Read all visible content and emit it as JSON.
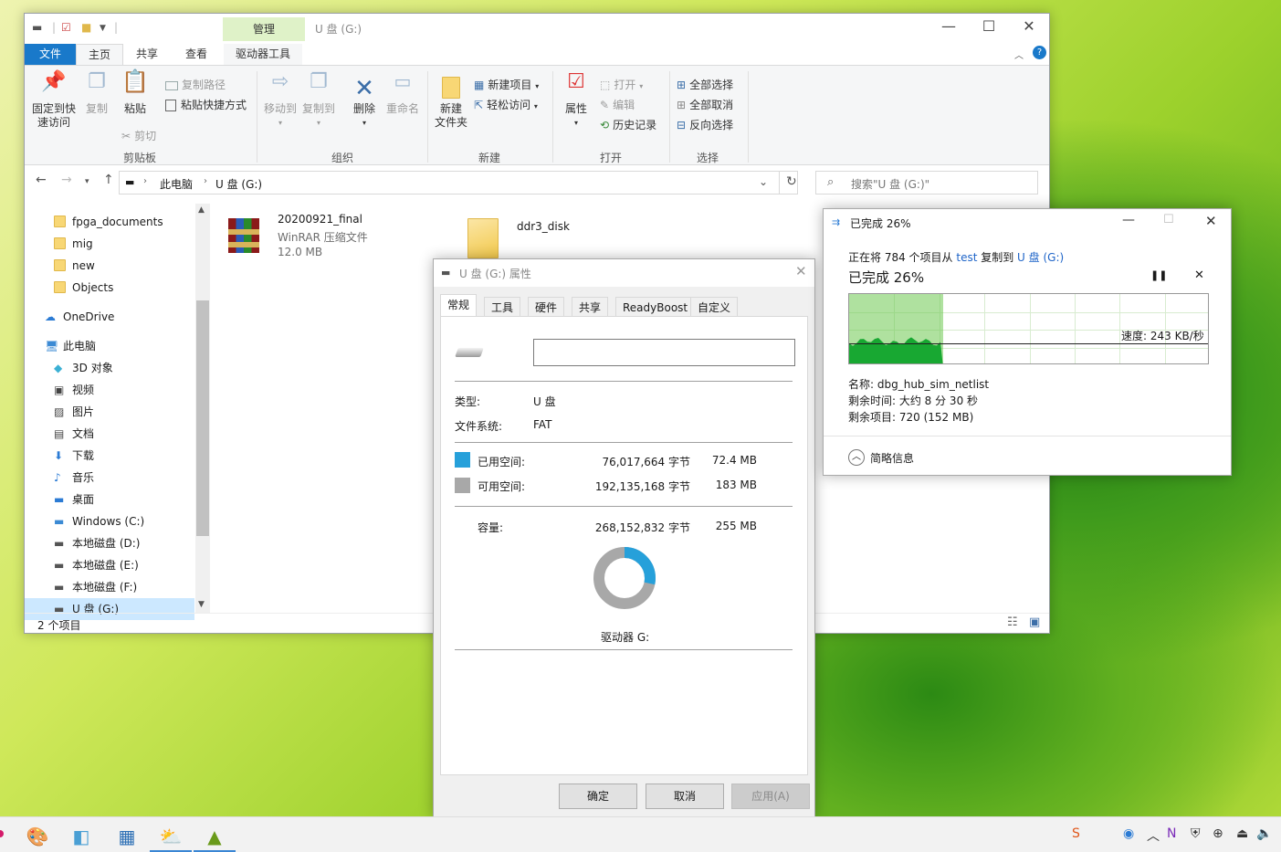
{
  "explorer": {
    "title": "U 盘 (G:)",
    "manage_tab": "管理",
    "tabs": [
      "文件",
      "主页",
      "共享",
      "查看",
      "驱动器工具"
    ],
    "ribbon": {
      "clipboard": {
        "pin": "固定到快\n速访问",
        "copy": "复制",
        "paste": "粘贴",
        "copy_path": "复制路径",
        "paste_shortcut": "粘贴快捷方式",
        "cut": "剪切",
        "group": "剪贴板"
      },
      "organize": {
        "move_to": "移动到",
        "copy_to": "复制到",
        "delete": "删除",
        "rename": "重命名",
        "group": "组织"
      },
      "new": {
        "new_folder": "新建\n文件夹",
        "new_item": "新建项目",
        "easy_access": "轻松访问",
        "group": "新建"
      },
      "open": {
        "properties": "属性",
        "open": "打开",
        "edit": "编辑",
        "history": "历史记录",
        "group": "打开"
      },
      "select": {
        "select_all": "全部选择",
        "select_none": "全部取消",
        "invert": "反向选择",
        "group": "选择"
      }
    },
    "address": {
      "crumbs": [
        "此电脑",
        "U 盘 (G:)"
      ]
    },
    "search_placeholder": "搜索\"U 盘 (G:)\"",
    "nav": [
      {
        "label": "fpga_documents",
        "icon": "folder-icon"
      },
      {
        "label": "mig",
        "icon": "folder-icon"
      },
      {
        "label": "new",
        "icon": "folder-icon"
      },
      {
        "label": "Objects",
        "icon": "folder-icon"
      },
      {
        "label": "OneDrive",
        "icon": "cloud-icon"
      },
      {
        "label": "此电脑",
        "icon": "computer-icon"
      },
      {
        "label": "3D 对象",
        "icon": "cube-icon"
      },
      {
        "label": "视频",
        "icon": "video-icon"
      },
      {
        "label": "图片",
        "icon": "picture-icon"
      },
      {
        "label": "文档",
        "icon": "document-icon"
      },
      {
        "label": "下载",
        "icon": "download-icon"
      },
      {
        "label": "音乐",
        "icon": "music-icon"
      },
      {
        "label": "桌面",
        "icon": "desktop-icon"
      },
      {
        "label": "Windows (C:)",
        "icon": "windows-drive-icon"
      },
      {
        "label": "本地磁盘 (D:)",
        "icon": "drive-icon"
      },
      {
        "label": "本地磁盘 (E:)",
        "icon": "drive-icon"
      },
      {
        "label": "本地磁盘 (F:)",
        "icon": "drive-icon"
      },
      {
        "label": "U 盘 (G:)",
        "icon": "usb-drive-icon"
      }
    ],
    "files": [
      {
        "name": "20200921_final",
        "type": "WinRAR 压缩文件",
        "size": "12.0 MB"
      },
      {
        "name": "ddr3_disk"
      }
    ],
    "status": "2 个项目"
  },
  "props": {
    "title": "U 盘 (G:) 属性",
    "tabs": [
      "常规",
      "工具",
      "硬件",
      "共享",
      "ReadyBoost",
      "自定义"
    ],
    "name_value": "",
    "type_label": "类型:",
    "type_value": "U 盘",
    "fs_label": "文件系统:",
    "fs_value": "FAT",
    "used_label": "已用空间:",
    "used_bytes": "76,017,664 字节",
    "used_size": "72.4 MB",
    "free_label": "可用空间:",
    "free_bytes": "192,135,168 字节",
    "free_size": "183 MB",
    "cap_label": "容量:",
    "cap_bytes": "268,152,832 字节",
    "cap_size": "255 MB",
    "used_fraction": 0.2835,
    "used_color": "#26a0da",
    "free_color": "#a8a8a8",
    "drive_label": "驱动器 G:",
    "ok": "确定",
    "cancel": "取消",
    "apply": "应用(A)"
  },
  "copy": {
    "title": "已完成 26%",
    "line_prefix": "正在将 784 个项目从 ",
    "src": "test",
    "line_mid": " 复制到 ",
    "dst": "U 盘 (G:)",
    "heading": "已完成 26%",
    "progress": 0.26,
    "speed": "速度: 243 KB/秒",
    "name": "名称: dbg_hub_sim_netlist",
    "time_left": "剩余时间: 大约 8 分 30 秒",
    "items_left": "剩余项目: 720 (152 MB)",
    "details": "简略信息"
  }
}
